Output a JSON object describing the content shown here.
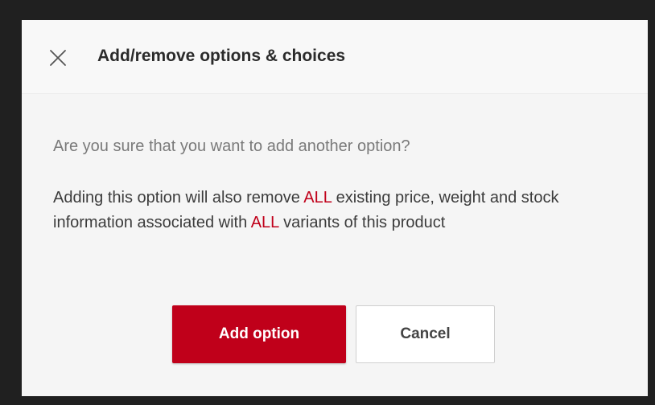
{
  "dialog": {
    "title": "Add/remove options & choices",
    "close_icon": "close-icon",
    "question": "Are you sure that you want to add another option?",
    "warning": {
      "part1": "Adding this option will also remove ",
      "em1": "ALL",
      "part2": " existing price, weight and stock information associated with ",
      "em2": "ALL",
      "part3": " variants of this product"
    },
    "buttons": {
      "primary_label": "Add option",
      "secondary_label": "Cancel"
    }
  },
  "colors": {
    "accent": "#c0001a",
    "backdrop": "#202020",
    "dialog_bg": "#f5f5f5"
  }
}
